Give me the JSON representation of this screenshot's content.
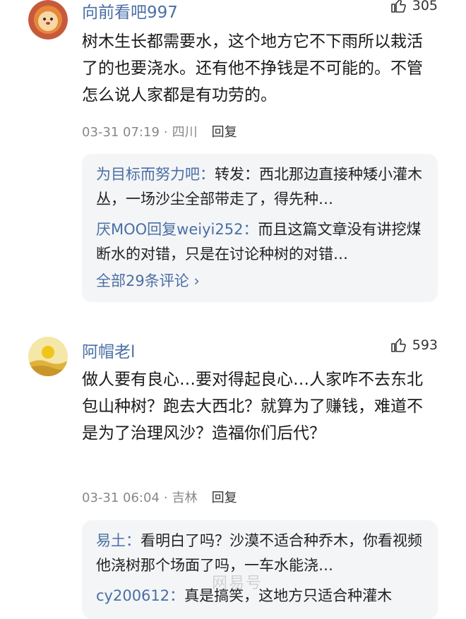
{
  "comments": [
    {
      "username": "向前看吧997",
      "likes": "305",
      "text": "树木生长都需要水，这个地方它不下雨所以栽活了的也要浇水。还有他不挣钱是不可能的。不管怎么说人家都是有功劳的。",
      "date": "03-31 07:19",
      "location": "四川",
      "reply_label": "回复",
      "replies": [
        {
          "name": "为目标而努力吧：",
          "text": "转发：西北那边直接种矮小灌木丛，一场沙尘全部带走了，得先种…"
        },
        {
          "name": "厌MOO回复weiyi252：",
          "text": "而且这篇文章没有讲挖煤断水的对错，只是在讨论种树的对错…"
        }
      ],
      "more": "全部29条评论 ›"
    },
    {
      "username": "阿帽老l",
      "likes": "593",
      "text": "做人要有良心…要对得起良心…人家咋不去东北包山种树？跑去大西北？就算为了赚钱，难道不是为了治理风沙？造福你们后代？",
      "date": "03-31 06:04",
      "location": "吉林",
      "reply_label": "回复",
      "replies": [
        {
          "name": "易土：",
          "text": "看明白了吗？沙漠不适合种乔木，你看视频他浇树那个场面了吗，一车水能浇…"
        },
        {
          "name": "cy200612：",
          "text": "真是搞笑，这地方只适合种灌木"
        }
      ]
    }
  ],
  "watermark": "网易号"
}
